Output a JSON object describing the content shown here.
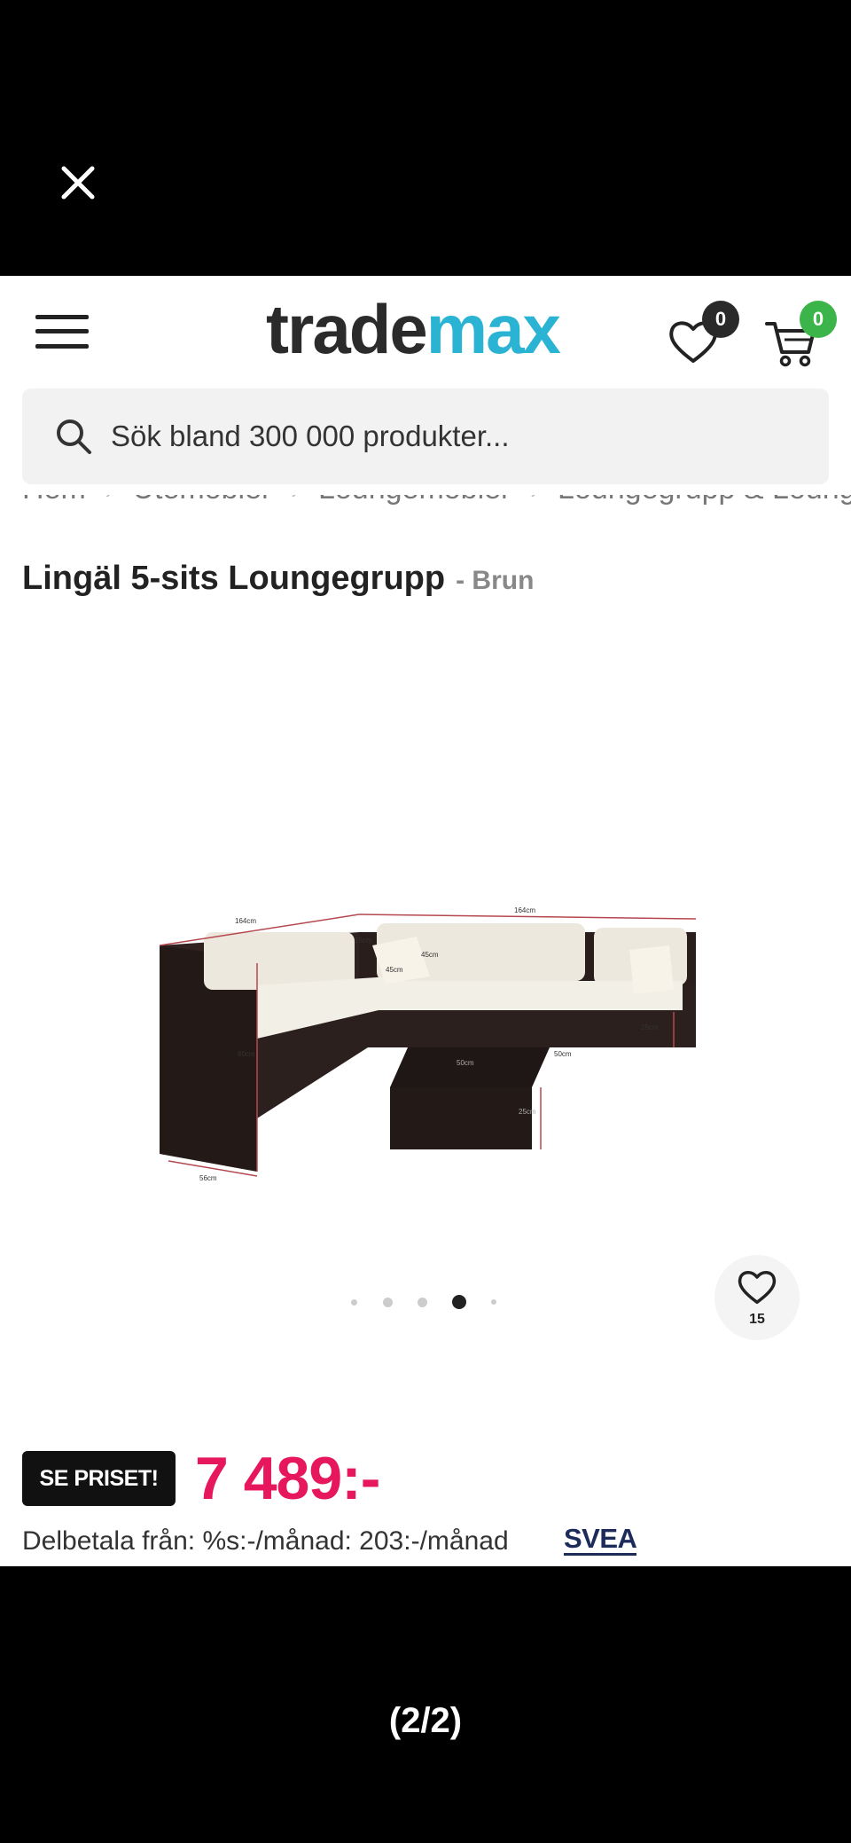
{
  "viewer": {
    "close_icon": "close-icon",
    "counter": "(2/2)"
  },
  "header": {
    "menu_icon": "hamburger-menu-icon",
    "logo_part1": "trade",
    "logo_part2": "max",
    "wishlist_count": "0",
    "cart_count": "0",
    "colors": {
      "logo_dark": "#2b2b2b",
      "logo_accent": "#2ab3d3",
      "cart_badge": "#3bb54a"
    }
  },
  "search": {
    "placeholder": "Sök bland 300 000 produkter..."
  },
  "breadcrumbs": [
    "Hem",
    "Utemöbler",
    "Loungemöbler",
    "Loungegrupp & Loungeset"
  ],
  "product": {
    "title": "Lingäl 5-sits Loungegrupp",
    "variant": "- Brun",
    "favorite_count": "15",
    "image_dimensions": {
      "width_left": "164cm",
      "width_right": "164cm",
      "depth": "56cm",
      "back_height": "60cm",
      "cushion_small": "15cm",
      "pillow_w": "45cm",
      "pillow_h": "45cm",
      "table_w": "50cm",
      "table_d": "50cm",
      "table_h": "25cm",
      "seat_h": "25cm"
    },
    "gallery": {
      "total": 5,
      "active": 4
    }
  },
  "pricing": {
    "badge": "SE PRISET!",
    "price": "7 489:-",
    "installment": "Delbetala från: %s:-/månad: 203:-/månad",
    "provider": "SVEA",
    "price_color": "#e6175c"
  }
}
